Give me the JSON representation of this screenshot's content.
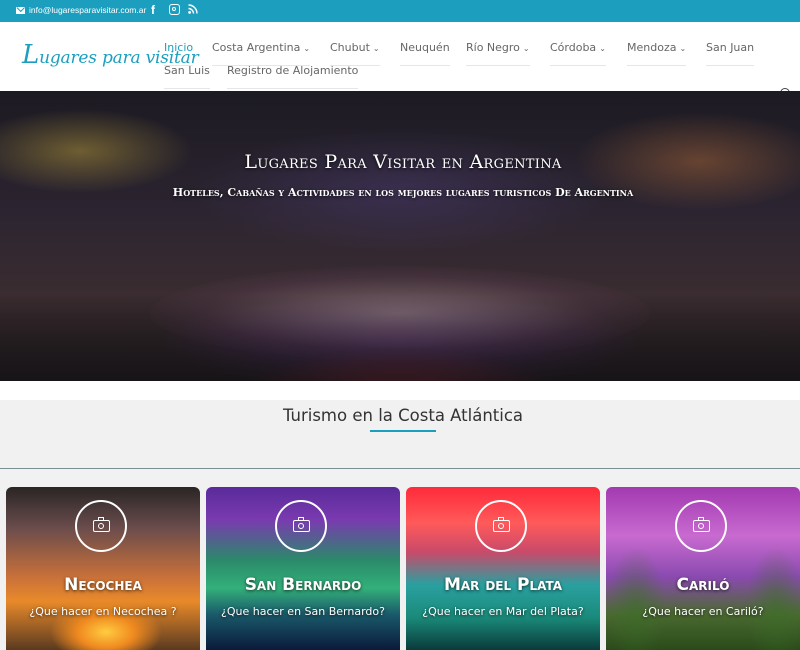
{
  "topbar": {
    "email": "info@lugaresparavisitar.com.ar",
    "facebook_label": "f",
    "icons": [
      "mail-icon",
      "facebook-icon",
      "instagram-icon",
      "rss-icon"
    ]
  },
  "header": {
    "logo": {
      "initial": "L",
      "rest": "ugares para visitar"
    },
    "nav": [
      {
        "label": "Inicio",
        "has_dropdown": false,
        "active": true
      },
      {
        "label": "Costa Argentina",
        "has_dropdown": true
      },
      {
        "label": "Chubut",
        "has_dropdown": true
      },
      {
        "label": "Neuquén",
        "has_dropdown": false
      },
      {
        "label": "Río Negro",
        "has_dropdown": true
      },
      {
        "label": "Córdoba",
        "has_dropdown": true
      },
      {
        "label": "Mendoza",
        "has_dropdown": true
      },
      {
        "label": "San Juan",
        "has_dropdown": false
      },
      {
        "label": "San Luis",
        "has_dropdown": false
      },
      {
        "label": "Registro de Alojamiento",
        "has_dropdown": false
      }
    ],
    "chevron": "⌄"
  },
  "hero": {
    "title": "Lugares Para Visitar en Argentina",
    "subtitle": "Hoteles, Cabañas y Actividades en los mejores lugares turisticos De Argentina"
  },
  "section": {
    "title": "Turismo en la Costa Atlántica",
    "cards": [
      {
        "title": "Necochea",
        "link": "¿Que hacer en Necochea ?"
      },
      {
        "title": "San Bernardo",
        "link": "¿Que hacer en San Bernardo?"
      },
      {
        "title": "Mar del Plata",
        "link": "¿Que hacer en Mar del Plata?"
      },
      {
        "title": "Cariló",
        "link": "¿Que hacer en Cariló?"
      }
    ]
  },
  "colors": {
    "accent": "#1c9fbf",
    "nav_text": "#666666",
    "section_bg": "#f1f1f1"
  }
}
